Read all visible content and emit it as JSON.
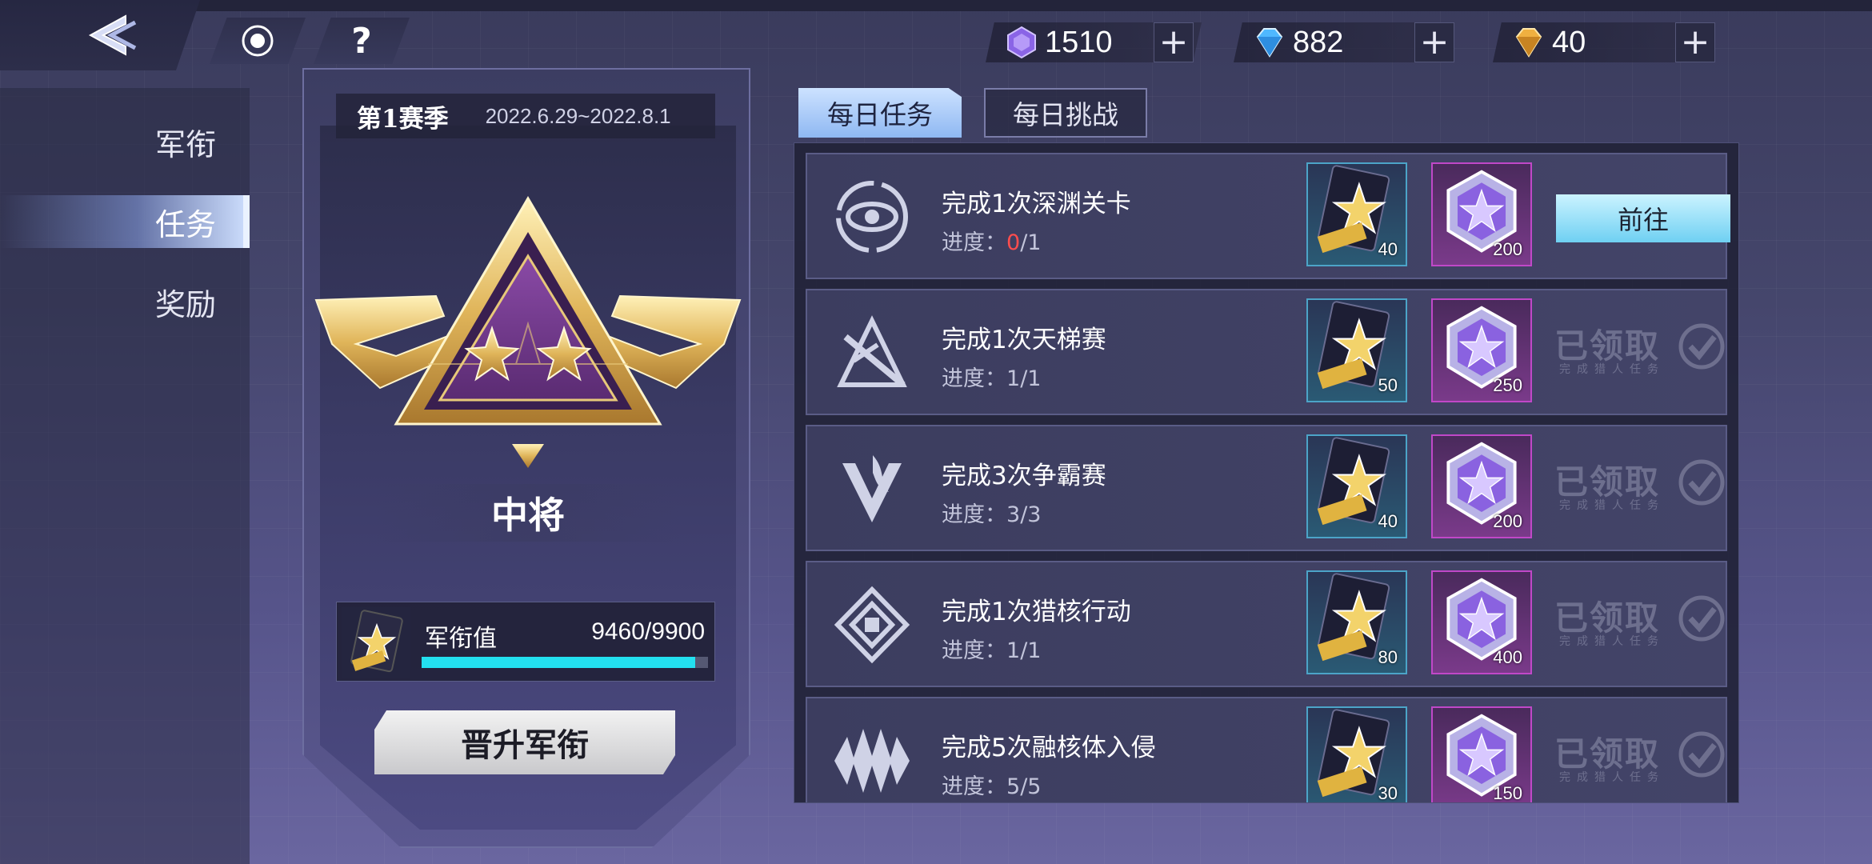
{
  "header": {
    "back_icon": "back-chevron-icon",
    "buttons": [
      {
        "icon": "record-icon"
      },
      {
        "icon": "help-icon",
        "label": "?"
      }
    ],
    "resources": [
      {
        "icon": "purple-crystal-icon",
        "value": "1510",
        "color": "#9b6cf0"
      },
      {
        "icon": "blue-diamond-icon",
        "value": "882",
        "color": "#4fb8ff"
      },
      {
        "icon": "gold-diamond-icon",
        "value": "40",
        "color": "#f0b040"
      }
    ],
    "plus_label": "+"
  },
  "sidebar": {
    "items": [
      {
        "label": "军衔",
        "active": false
      },
      {
        "label": "任务",
        "active": true
      },
      {
        "label": "奖励",
        "active": false
      }
    ]
  },
  "rank": {
    "season": "第1赛季",
    "date_range": "2022.6.29~2022.8.1",
    "title": "中将",
    "points_label": "军衔值",
    "points_text": "9460/9900",
    "points_current": 9460,
    "points_max": 9900,
    "promote_label": "晋升军衔"
  },
  "tabs": [
    {
      "label": "每日任务",
      "active": true
    },
    {
      "label": "每日挑战",
      "active": false
    }
  ],
  "tasks": [
    {
      "name": "完成1次深渊关卡",
      "progress_label": "进度：",
      "progress_current": "0",
      "progress_total": "/1",
      "icon": "abyss-eye-icon",
      "card_reward": "40",
      "gem_reward": "200",
      "status": "go",
      "action_label": "前往"
    },
    {
      "name": "完成1次天梯赛",
      "progress_label": "进度：",
      "progress_current": "1",
      "progress_total": "/1",
      "icon": "ladder-blade-icon",
      "card_reward": "50",
      "gem_reward": "250",
      "status": "claimed",
      "claimed_label": "已领取",
      "claimed_sub": "完成猎人任务"
    },
    {
      "name": "完成3次争霸赛",
      "progress_label": "进度：",
      "progress_current": "3",
      "progress_total": "/3",
      "icon": "flame-v-icon",
      "card_reward": "40",
      "gem_reward": "200",
      "status": "claimed",
      "claimed_label": "已领取",
      "claimed_sub": "完成猎人任务"
    },
    {
      "name": "完成1次猎核行动",
      "progress_label": "进度：",
      "progress_current": "1",
      "progress_total": "/1",
      "icon": "core-hunt-icon",
      "card_reward": "80",
      "gem_reward": "400",
      "status": "claimed",
      "claimed_label": "已领取",
      "claimed_sub": "完成猎人任务"
    },
    {
      "name": "完成5次融核体入侵",
      "progress_label": "进度：",
      "progress_current": "5",
      "progress_total": "/5",
      "icon": "invasion-spikes-icon",
      "card_reward": "30",
      "gem_reward": "150",
      "status": "claimed",
      "claimed_label": "已领取",
      "claimed_sub": "完成猎人任务"
    }
  ]
}
